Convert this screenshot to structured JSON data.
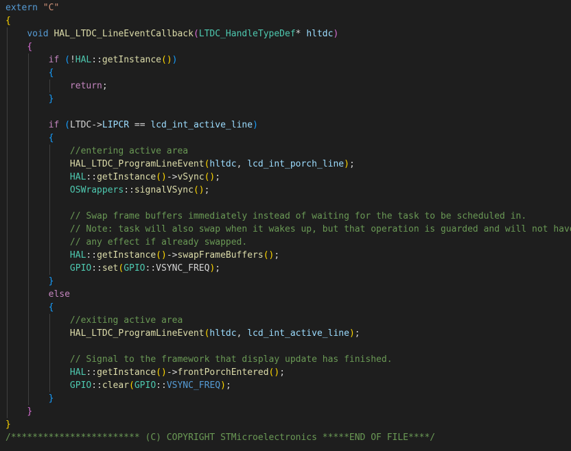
{
  "lines": [
    [
      [
        "kw",
        "extern"
      ],
      [
        "op",
        " "
      ],
      [
        "str",
        "\"C\""
      ]
    ],
    [
      [
        "b1",
        "{"
      ]
    ],
    [
      [
        "op",
        "    "
      ],
      [
        "kw",
        "void"
      ],
      [
        "op",
        " "
      ],
      [
        "fn",
        "HAL_LTDC_LineEventCallback"
      ],
      [
        "b2",
        "("
      ],
      [
        "ty",
        "LTDC_HandleTypeDef"
      ],
      [
        "op",
        "* "
      ],
      [
        "var",
        "hltdc"
      ],
      [
        "b2",
        ")"
      ]
    ],
    [
      [
        "op",
        "    "
      ],
      [
        "b2",
        "{"
      ]
    ],
    [
      [
        "op",
        "        "
      ],
      [
        "ctl",
        "if"
      ],
      [
        "op",
        " "
      ],
      [
        "b3",
        "("
      ],
      [
        "op",
        "!"
      ],
      [
        "ty",
        "HAL"
      ],
      [
        "op",
        "::"
      ],
      [
        "fn",
        "getInstance"
      ],
      [
        "b1",
        "()"
      ],
      [
        "b3",
        ")"
      ]
    ],
    [
      [
        "op",
        "        "
      ],
      [
        "b3",
        "{"
      ]
    ],
    [
      [
        "op",
        "            "
      ],
      [
        "ctl",
        "return"
      ],
      [
        "op",
        ";"
      ]
    ],
    [
      [
        "op",
        "        "
      ],
      [
        "b3",
        "}"
      ]
    ],
    [],
    [
      [
        "op",
        "        "
      ],
      [
        "ctl",
        "if"
      ],
      [
        "op",
        " "
      ],
      [
        "b3",
        "("
      ],
      [
        "op",
        "LTDC->"
      ],
      [
        "var",
        "LIPCR"
      ],
      [
        "op",
        " == "
      ],
      [
        "var",
        "lcd_int_active_line"
      ],
      [
        "b3",
        ")"
      ]
    ],
    [
      [
        "op",
        "        "
      ],
      [
        "b3",
        "{"
      ]
    ],
    [
      [
        "op",
        "            "
      ],
      [
        "cm",
        "//entering active area"
      ]
    ],
    [
      [
        "op",
        "            "
      ],
      [
        "fn",
        "HAL_LTDC_ProgramLineEvent"
      ],
      [
        "b1",
        "("
      ],
      [
        "var",
        "hltdc"
      ],
      [
        "op",
        ", "
      ],
      [
        "var",
        "lcd_int_porch_line"
      ],
      [
        "b1",
        ")"
      ],
      [
        "op",
        ";"
      ]
    ],
    [
      [
        "op",
        "            "
      ],
      [
        "ty",
        "HAL"
      ],
      [
        "op",
        "::"
      ],
      [
        "fn",
        "getInstance"
      ],
      [
        "b1",
        "()"
      ],
      [
        "op",
        "->"
      ],
      [
        "fn",
        "vSync"
      ],
      [
        "b1",
        "()"
      ],
      [
        "op",
        ";"
      ]
    ],
    [
      [
        "op",
        "            "
      ],
      [
        "ty",
        "OSWrappers"
      ],
      [
        "op",
        "::"
      ],
      [
        "fn",
        "signalVSync"
      ],
      [
        "b1",
        "()"
      ],
      [
        "op",
        ";"
      ]
    ],
    [],
    [
      [
        "op",
        "            "
      ],
      [
        "cm",
        "// Swap frame buffers immediately instead of waiting for the task to be scheduled in."
      ]
    ],
    [
      [
        "op",
        "            "
      ],
      [
        "cm",
        "// Note: task will also swap when it wakes up, but that operation is guarded and will not have"
      ]
    ],
    [
      [
        "op",
        "            "
      ],
      [
        "cm",
        "// any effect if already swapped."
      ]
    ],
    [
      [
        "op",
        "            "
      ],
      [
        "ty",
        "HAL"
      ],
      [
        "op",
        "::"
      ],
      [
        "fn",
        "getInstance"
      ],
      [
        "b1",
        "()"
      ],
      [
        "op",
        "->"
      ],
      [
        "fn",
        "swapFrameBuffers"
      ],
      [
        "b1",
        "()"
      ],
      [
        "op",
        ";"
      ]
    ],
    [
      [
        "op",
        "            "
      ],
      [
        "ty",
        "GPIO"
      ],
      [
        "op",
        "::"
      ],
      [
        "fn",
        "set"
      ],
      [
        "b1",
        "("
      ],
      [
        "ty",
        "GPIO"
      ],
      [
        "op",
        "::VSYNC_FREQ"
      ],
      [
        "b1",
        ")"
      ],
      [
        "op",
        ";"
      ]
    ],
    [
      [
        "op",
        "        "
      ],
      [
        "b3",
        "}"
      ]
    ],
    [
      [
        "op",
        "        "
      ],
      [
        "ctl",
        "else"
      ]
    ],
    [
      [
        "op",
        "        "
      ],
      [
        "b3",
        "{"
      ]
    ],
    [
      [
        "op",
        "            "
      ],
      [
        "cm",
        "//exiting active area"
      ]
    ],
    [
      [
        "op",
        "            "
      ],
      [
        "fn",
        "HAL_LTDC_ProgramLineEvent"
      ],
      [
        "b1",
        "("
      ],
      [
        "var",
        "hltdc"
      ],
      [
        "op",
        ", "
      ],
      [
        "var",
        "lcd_int_active_line"
      ],
      [
        "b1",
        ")"
      ],
      [
        "op",
        ";"
      ]
    ],
    [],
    [
      [
        "op",
        "            "
      ],
      [
        "cm",
        "// Signal to the framework that display update has finished."
      ]
    ],
    [
      [
        "op",
        "            "
      ],
      [
        "ty",
        "HAL"
      ],
      [
        "op",
        "::"
      ],
      [
        "fn",
        "getInstance"
      ],
      [
        "b1",
        "()"
      ],
      [
        "op",
        "->"
      ],
      [
        "fn",
        "frontPorchEntered"
      ],
      [
        "b1",
        "()"
      ],
      [
        "op",
        ";"
      ]
    ],
    [
      [
        "op",
        "            "
      ],
      [
        "ty",
        "GPIO"
      ],
      [
        "op",
        "::"
      ],
      [
        "fn",
        "clear"
      ],
      [
        "b1",
        "("
      ],
      [
        "ty",
        "GPIO"
      ],
      [
        "op",
        "::"
      ],
      [
        "macro",
        "VSYNC_FREQ"
      ],
      [
        "b1",
        ")"
      ],
      [
        "op",
        ";"
      ]
    ],
    [
      [
        "op",
        "        "
      ],
      [
        "b3",
        "}"
      ]
    ],
    [
      [
        "op",
        "    "
      ],
      [
        "b2",
        "}"
      ]
    ],
    [
      [
        "b1",
        "}"
      ]
    ],
    [
      [
        "cm",
        "/************************ (C) COPYRIGHT STMicroelectronics *****END OF FILE****/"
      ]
    ]
  ]
}
